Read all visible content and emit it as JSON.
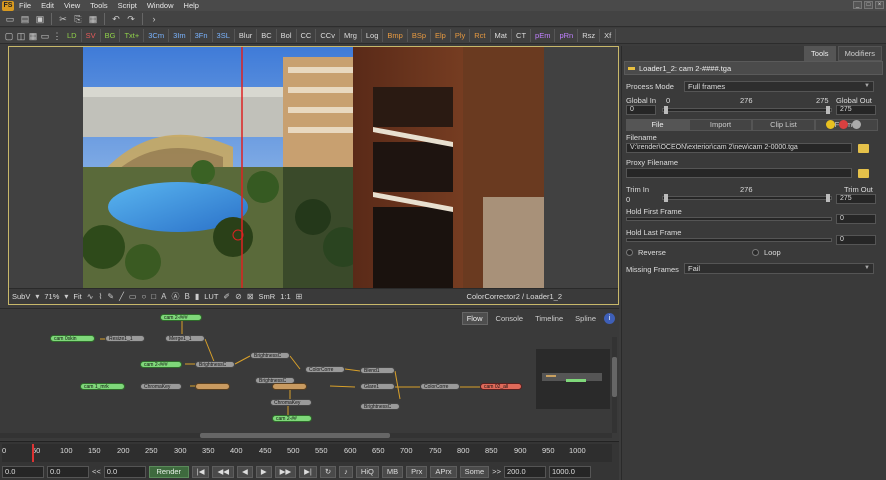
{
  "app": {
    "logo": "FS",
    "menu": [
      "File",
      "Edit",
      "View",
      "Tools",
      "Script",
      "Window",
      "Help"
    ]
  },
  "toolbar2": {
    "buttons": [
      "LD",
      "SV",
      "BG",
      "Txt+",
      "3Cm",
      "3Im",
      "3Fn",
      "3SL",
      "Blur",
      "BC",
      "Bol",
      "CC",
      "CCv",
      "Mrg",
      "Log",
      "Bmp",
      "BSp",
      "Elp",
      "Ply",
      "Rct",
      "Mat",
      "CT",
      "pEm",
      "pRn",
      "Rsz",
      "Xf"
    ]
  },
  "viewer": {
    "subview": "SubV",
    "zoom": "71%",
    "fit": "Fit",
    "lut": "LUT",
    "smr": "SmR",
    "ratio": "1:1",
    "title": "ColorCorrector2 / Loader1_2"
  },
  "flow": {
    "tabs": [
      "Flow",
      "Console",
      "Timeline",
      "Spline"
    ],
    "active_tab": "Flow",
    "info": "i",
    "nodes": [
      "cam 2-###",
      "cam 0skin",
      "Resize1_1",
      "Merge1_1",
      "cam 2-###",
      "cam 1_mrk",
      "ChromaKey",
      "BrightnessC",
      "BrightnessC",
      "ColorCorre",
      "Blend1",
      "BrightnessC",
      "Glare1",
      "BrightnessC",
      "ChromaKey",
      "cam 2-##",
      "ColorCorre",
      "cam 02_all"
    ]
  },
  "timeline": {
    "ticks": [
      "0",
      "50",
      "100",
      "150",
      "200",
      "250",
      "300",
      "350",
      "400",
      "450",
      "500",
      "550",
      "600",
      "650",
      "700",
      "750",
      "800",
      "850",
      "900",
      "950",
      "1000"
    ],
    "current": "0.0",
    "start": "0.0",
    "render_start": "0.0",
    "prev": "<<",
    "render": "Render",
    "hiq": "HiQ",
    "mb": "MB",
    "prx": "Prx",
    "aprx": "APrx",
    "some": "Some",
    "next": ">>",
    "render_end": "200.0",
    "end": "1000.0"
  },
  "panel": {
    "tabs": [
      "Tools",
      "Modifiers"
    ],
    "active_tab": "Tools",
    "header": "Loader1_2: cam 2-####.tga",
    "process_mode_label": "Process Mode",
    "process_mode_value": "Full frames",
    "global_in_label": "Global In",
    "global_out_label": "Global Out",
    "global_in_min": "0",
    "global_mid": "276",
    "global_max": "275",
    "global_in_value": "0",
    "global_out_value": "275",
    "sub_tabs": [
      "File",
      "Import",
      "Clip List",
      "Format"
    ],
    "active_sub_tab": "File",
    "filename_label": "Filename",
    "filename_value": "V:\\render\\OCEON\\exterior\\cam 2\\new\\cam 2-0000.tga",
    "proxy_label": "Proxy Filename",
    "proxy_value": "",
    "trim_in_label": "Trim In",
    "trim_out_label": "Trim Out",
    "trim_mid": "276",
    "trim_in_value": "0",
    "trim_out_value": "275",
    "hold_first_label": "Hold First Frame",
    "hold_first_value": "0",
    "hold_last_label": "Hold Last Frame",
    "hold_last_value": "0",
    "reverse_label": "Reverse",
    "loop_label": "Loop",
    "missing_label": "Missing Frames",
    "missing_value": "Fail"
  },
  "colors": {
    "accent_yellow": "#c8b86a",
    "node_green": "#7fd87a",
    "node_red": "#e06a5a",
    "playhead": "#dd3333"
  }
}
